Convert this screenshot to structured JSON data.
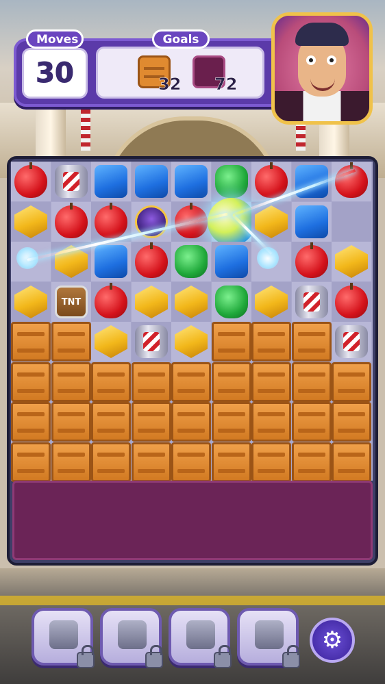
{
  "hud": {
    "moves_label": "Moves",
    "moves_value": "30",
    "goals_label": "Goals",
    "goals": [
      {
        "icon": "crate-icon",
        "count": "32"
      },
      {
        "icon": "purple-tile-icon",
        "count": "72"
      }
    ]
  },
  "tnt_label": "TNT",
  "settings_icon": "⚙",
  "colors": {
    "hud": "#5b3aa9",
    "crate": "#e08a30",
    "purple_goal": "#6a1f4d",
    "board": "#3e3f67"
  },
  "board": {
    "cols": 9,
    "rows": [
      [
        "apple",
        "barrel",
        "cube",
        "cube",
        "cube",
        "pot",
        "apple",
        "cube",
        "apple"
      ],
      [
        "gem",
        "apple",
        "apple",
        "beetle",
        "apple",
        "disco",
        "gem",
        "cube",
        ""
      ],
      [
        "flash",
        "gem",
        "cube",
        "apple",
        "pot",
        "cube",
        "flash",
        "apple",
        "gem"
      ],
      [
        "gem",
        "tnt",
        "apple",
        "gem",
        "gem",
        "pot",
        "gem",
        "barrel",
        "apple"
      ],
      [
        "crate",
        "crate",
        "gem",
        "barrel",
        "gem",
        "crate",
        "crate",
        "crate",
        "barrel"
      ],
      [
        "crate",
        "crate",
        "crate",
        "crate",
        "crate",
        "crate",
        "crate",
        "crate",
        "crate"
      ],
      [
        "crate",
        "crate",
        "crate",
        "crate",
        "crate",
        "crate",
        "crate",
        "crate",
        "crate"
      ],
      [
        "crate",
        "crate",
        "crate",
        "crate",
        "crate",
        "crate",
        "crate",
        "crate",
        "crate"
      ]
    ]
  },
  "boosters": [
    {
      "name": "hammer-booster",
      "icon": "hammer-icon",
      "locked": true
    },
    {
      "name": "glove-booster",
      "icon": "glove-icon",
      "locked": true
    },
    {
      "name": "cannon-booster",
      "icon": "cannon-icon",
      "locked": true
    },
    {
      "name": "anvil-booster",
      "icon": "anvil-icon",
      "locked": true
    }
  ]
}
